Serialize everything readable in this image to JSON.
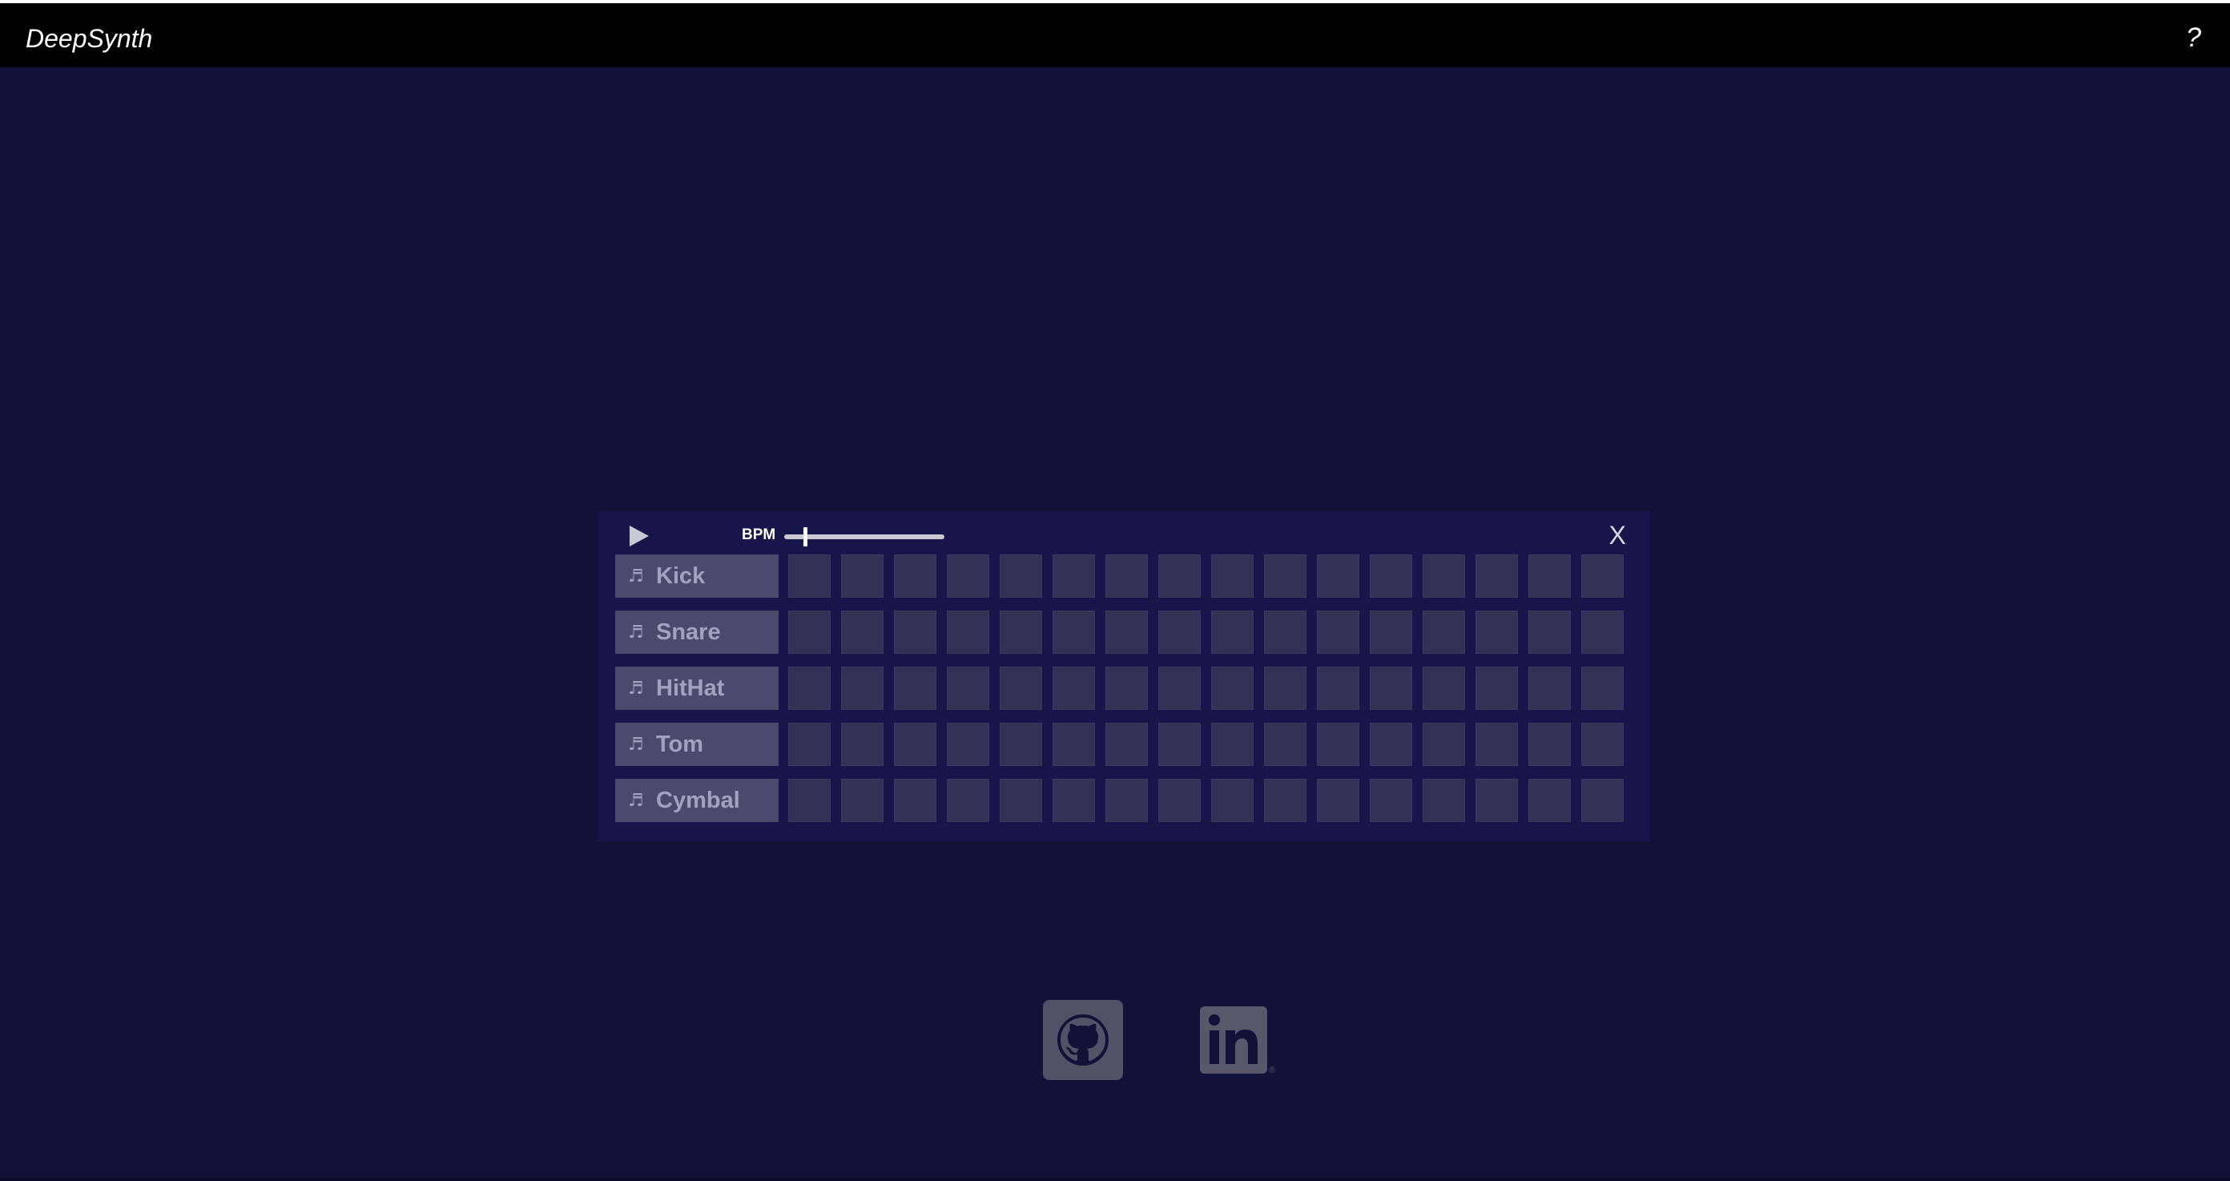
{
  "app": {
    "brand": "DeepSynth",
    "help_label": "?"
  },
  "sequencer": {
    "bpm_label": "BPM",
    "bpm_slider_fraction": 0.12,
    "close_label": "X",
    "steps": 16,
    "instruments": [
      {
        "icon": "music-note-icon",
        "label": "Kick"
      },
      {
        "icon": "music-note-icon",
        "label": "Snare"
      },
      {
        "icon": "music-note-icon",
        "label": "HitHat"
      },
      {
        "icon": "music-note-icon",
        "label": "Tom"
      },
      {
        "icon": "music-note-icon",
        "label": "Cymbal"
      }
    ]
  },
  "footer": {
    "links": [
      {
        "name": "github-icon"
      },
      {
        "name": "linkedin-icon"
      }
    ]
  },
  "colors": {
    "background": "#121238",
    "topbar": "#000000",
    "panel": "#16164a",
    "cell": "#323257",
    "instrument_button": "#4a4a6e",
    "instrument_text": "#a2a2c0"
  }
}
